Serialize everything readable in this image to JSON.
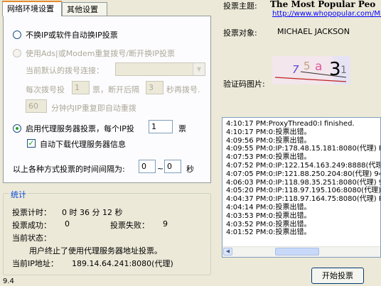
{
  "tabs": [
    {
      "label": "网络环境设置"
    },
    {
      "label": "其他设置"
    }
  ],
  "network": {
    "no_change_ip_label": "不换IP或软件自动换IP投票",
    "adsl_label": "使用Ads|或Modem重复拨号/断开换IP投票",
    "current_dial_label": "当前默认的拨号连接：",
    "current_dial_value": "",
    "every_dial_prefix": "每次拨号投",
    "every_dial_value": "1",
    "every_dial_mid": "票，断开后隔",
    "wait_value": "3",
    "wait_suffix": "秒再拨号.",
    "ip_repeat_value": "60",
    "ip_repeat_suffix": "分钟内IP重复即自动重拨",
    "proxy_label": "启用代理服务器投票，每个IP投",
    "proxy_votes_value": "1",
    "proxy_votes_suffix": "票",
    "auto_download_label": "自动下载代理服务器信息",
    "interval_label": "以上各种方式投票的时间间隔为:",
    "interval_from": "0",
    "interval_sep": "~",
    "interval_to": "0",
    "interval_unit": "秒"
  },
  "stats": {
    "title": "统计",
    "time_label": "投票计时：",
    "time_value": "0 时 36 分 12 秒",
    "success_label": "投票成功：",
    "success_value": "0",
    "fail_label": "投票失败：",
    "fail_value": "9",
    "status_label": "当前状态：",
    "status_message": "用户终止了使用代理服务器地址投票。",
    "ip_label": "当前IP地址：",
    "ip_value": "189.14.64.241:8080(代理)"
  },
  "right": {
    "topic_label": "投票主题:",
    "topic_value": "The Most Popular Peo",
    "topic_url": "http://www.whopopular.com/Mi",
    "target_label": "投票对象:",
    "target_value": "MICHAEL JACKSON",
    "captcha_label": "验证码图片:",
    "captcha_chars": [
      "7",
      "5",
      "a",
      "3",
      "1"
    ]
  },
  "log": [
    "4:10:17 PM:ProxyThread0:I finished.",
    "4:10:17 PM:0:投票出错。",
    "4:09:56 PM:0:投票出错。",
    "4:09:55 PM:0:IP:178.48.15.181:8080(代理) P0",
    "4:07:53 PM:0:投票出错。",
    "4:07:52 PM:0:IP:122.154.163.249:8888(代理)",
    "4:07:05 PM:0:IP:121.88.250.204:80(代理) 94",
    "4:06:03 PM:0:IP:118.98.35.251:8080(代理) 94",
    "4:05:20 PM:0:IP:118.97.195.106:8080(代理) 5",
    "4:04:37 PM:0:IP:118.97.164.75:8080(代理) P0",
    "4:04:14 PM:0:投票出错。",
    "4:03:53 PM:0:投票出错。",
    "4:03:52 PM:0:投票出错。",
    "4:01:52 PM:0:投票出错。"
  ],
  "start_button": "开始投票",
  "version": "9.4"
}
